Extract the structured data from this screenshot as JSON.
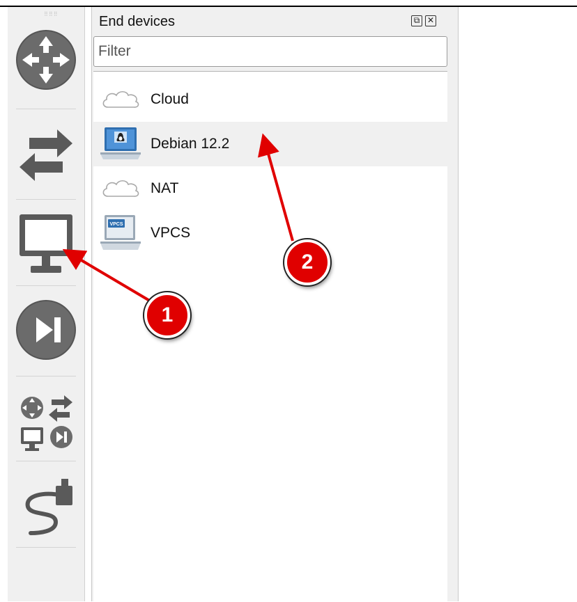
{
  "toolbar": {
    "buttons": [
      {
        "name": "routers-category-button",
        "icon": "router-icon"
      },
      {
        "name": "switches-category-button",
        "icon": "switch-icon"
      },
      {
        "name": "end-devices-category-button",
        "icon": "monitor-icon"
      },
      {
        "name": "security-devices-category-button",
        "icon": "skip-forward-icon"
      },
      {
        "name": "all-devices-category-button",
        "icon": "all-devices-icon"
      },
      {
        "name": "add-link-button",
        "icon": "cable-icon"
      }
    ]
  },
  "dock": {
    "title": "End devices",
    "controls": {
      "float_icon": "restore-icon",
      "close_icon": "close-icon"
    },
    "filter": {
      "placeholder": "Filter",
      "value": ""
    },
    "items": [
      {
        "label": "Cloud",
        "icon": "cloud-icon",
        "selected": false
      },
      {
        "label": "Debian 12.2",
        "icon": "debian-laptop-icon",
        "selected": true
      },
      {
        "label": "NAT",
        "icon": "cloud-icon",
        "selected": false
      },
      {
        "label": "VPCS",
        "icon": "vpcs-laptop-icon",
        "selected": false,
        "icon_text": "VPCS"
      }
    ]
  },
  "annotations": [
    {
      "number": "1",
      "color": "#e00000"
    },
    {
      "number": "2",
      "color": "#e00000"
    }
  ]
}
